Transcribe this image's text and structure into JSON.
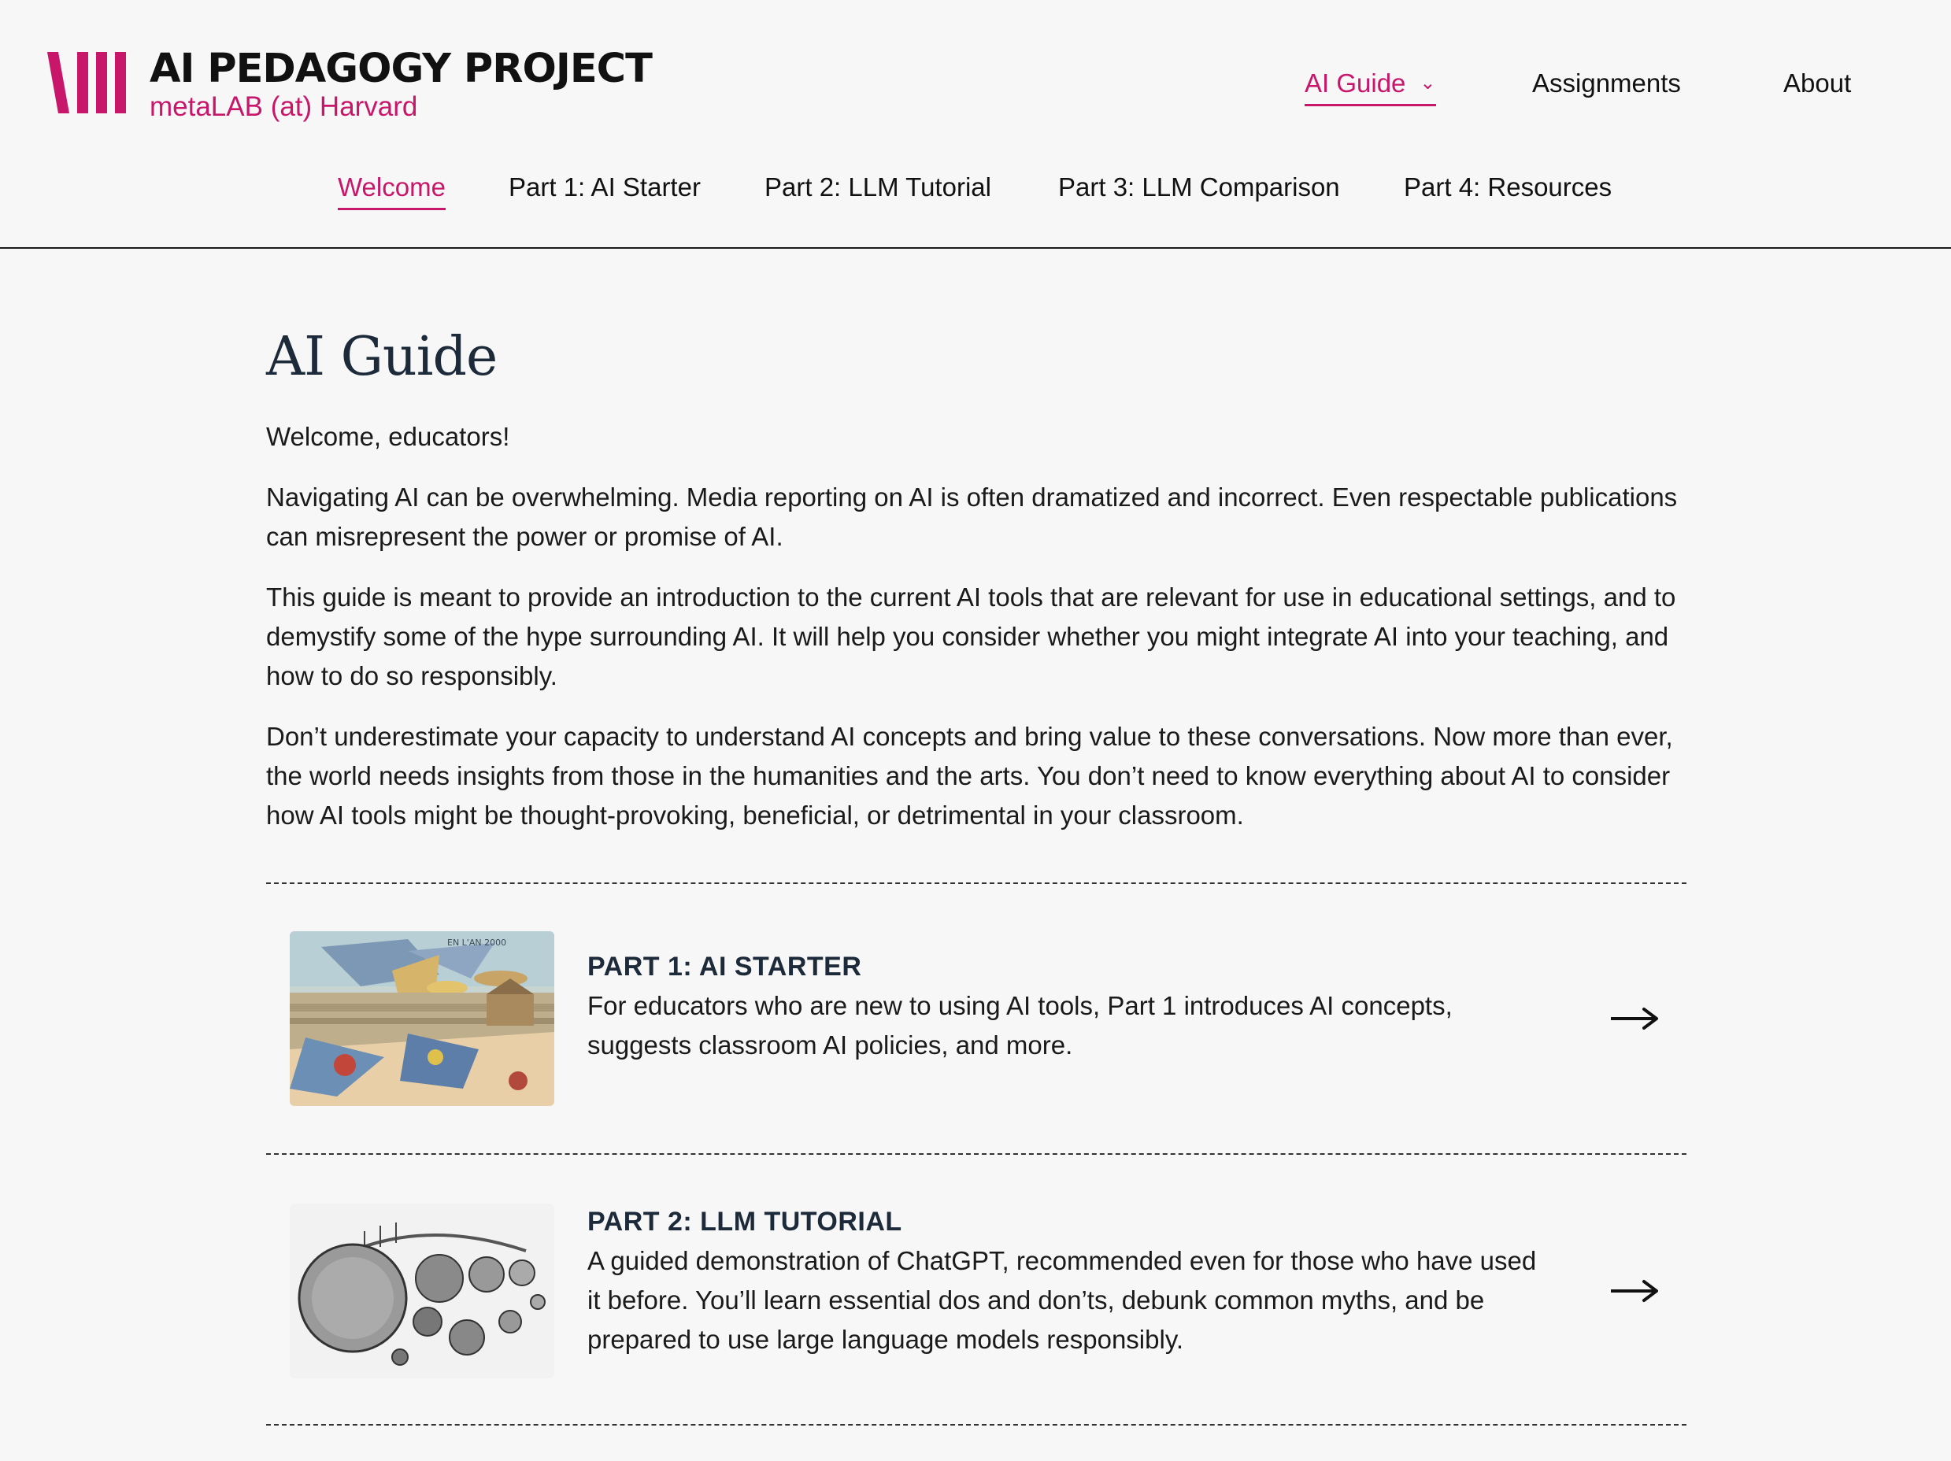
{
  "site": {
    "title": "AI PEDAGOGY PROJECT",
    "subtitle": "metaLAB (at) Harvard",
    "logo_icon": "metalab-bars-logo",
    "accent_color": "#c8176a"
  },
  "top_nav": {
    "items": [
      {
        "label": "AI Guide",
        "active": true,
        "has_dropdown": true
      },
      {
        "label": "Assignments",
        "active": false
      },
      {
        "label": "About",
        "active": false
      }
    ]
  },
  "sub_nav": {
    "items": [
      {
        "label": "Welcome",
        "active": true
      },
      {
        "label": "Part 1: AI Starter",
        "active": false
      },
      {
        "label": "Part 2: LLM Tutorial",
        "active": false
      },
      {
        "label": "Part 3: LLM Comparison",
        "active": false
      },
      {
        "label": "Part 4: Resources",
        "active": false
      }
    ]
  },
  "main": {
    "heading": "AI Guide",
    "paragraphs": [
      "Welcome, educators!",
      "Navigating AI can be overwhelming. Media reporting on AI is often dramatized and incorrect. Even respectable publications can misrepresent the power or promise of AI.",
      "This guide is meant to provide an introduction to the current AI tools that are relevant for use in educational settings, and to demystify some of the hype surrounding AI. It will help you consider whether you might integrate AI into your teaching, and how to do so responsibly.",
      "Don’t underestimate your capacity to understand AI concepts and bring value to these conversations. Now more than ever, the world needs insights from those in the humanities and the arts. You don’t need to know everything about AI to consider how AI tools might be thought-provoking, beneficial, or detrimental in your classroom."
    ],
    "cards": [
      {
        "title": "PART 1: AI STARTER",
        "description": "For educators who are new to using AI tools, Part 1 introduces AI concepts, suggests classroom AI policies, and more.",
        "image_caption": "EN L'AN 2000",
        "image_icon": "vintage-flying-machines-illustration",
        "arrow_icon": "arrow-right-icon"
      },
      {
        "title": "PART 2: LLM TUTORIAL",
        "description": "A guided demonstration of ChatGPT, recommended even for those who have used it before. You’ll learn essential dos and don’ts, debunk common myths, and be prepared to use large language models responsibly.",
        "image_icon": "engraving-planets-orrery-illustration",
        "arrow_icon": "arrow-right-icon"
      }
    ]
  }
}
